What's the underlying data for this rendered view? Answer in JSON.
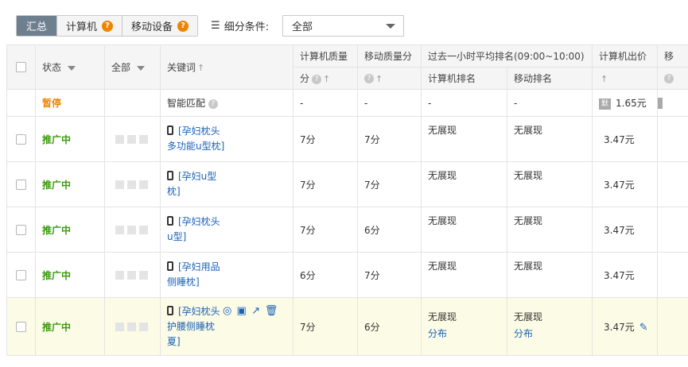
{
  "toolbar": {
    "tabs": [
      {
        "label": "汇总",
        "badge": ""
      },
      {
        "label": "计算机",
        "badge": "?"
      },
      {
        "label": "移动设备",
        "badge": "?"
      }
    ],
    "filter_label": "细分条件:",
    "filter_value": "全部"
  },
  "header": {
    "status": "状态",
    "all": "全部",
    "keyword": "关键词",
    "pc_quality": "计算机质量",
    "pc_quality_unit": "分",
    "mobile_quality": "移动质量分",
    "rank_group": "过去一小时平均排名(09:00~10:00)",
    "pc_rank": "计算机排名",
    "mobile_rank": "移动排名",
    "pc_bid": "计算机出价",
    "next_col": "移"
  },
  "rows": [
    {
      "status": "暂停",
      "kw": "智能匹配",
      "pcq": "-",
      "mq": "-",
      "pcr": "-",
      "mr": "-",
      "price": "1.65元",
      "price_icon": "默"
    },
    {
      "status": "推广中",
      "kw1": "[孕妇枕头",
      "kw2": "多功能u型枕]",
      "pcq": "7分",
      "mq": "7分",
      "pcr": "无展现",
      "mr": "无展现",
      "price": "3.47元"
    },
    {
      "status": "推广中",
      "kw1": "[孕妇u型",
      "kw2": "枕]",
      "pcq": "7分",
      "mq": "7分",
      "pcr": "无展现",
      "mr": "无展现",
      "price": "3.47元"
    },
    {
      "status": "推广中",
      "kw1": "[孕妇枕头",
      "kw2": "u型]",
      "pcq": "7分",
      "mq": "6分",
      "pcr": "无展现",
      "mr": "无展现",
      "price": "3.47元"
    },
    {
      "status": "推广中",
      "kw1": "[孕妇用品",
      "kw2": "侧睡枕]",
      "pcq": "6分",
      "mq": "7分",
      "pcr": "无展现",
      "mr": "无展现",
      "price": "3.47元"
    },
    {
      "status": "推广中",
      "kw1": "[孕妇枕头",
      "kw2": "护腰侧睡枕",
      "kw3": "夏]",
      "pcq": "7分",
      "mq": "6分",
      "pcr": "无展现",
      "pcr_link": "分布",
      "mr": "无展现",
      "mr_link": "分布",
      "price": "3.47元"
    }
  ],
  "colors": {
    "accent_orange": "#f08300",
    "green_status": "#3a9a0d",
    "link_blue": "#1a62b8",
    "header_red": "#e4393c",
    "highlight_row": "#fbfbe6"
  },
  "icons": [
    "list-icon",
    "phone-icon",
    "target-icon",
    "image-icon",
    "trend-chart-icon",
    "trash-icon",
    "pencil-edit-icon"
  ]
}
